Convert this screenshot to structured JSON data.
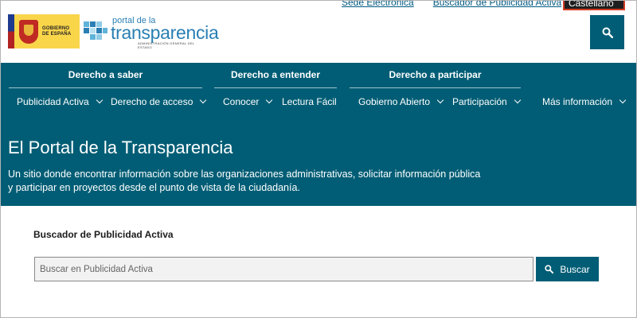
{
  "header": {
    "gobierno_logo_text": [
      "GOBIERNO",
      "DE ESPAÑA"
    ],
    "portal_logo": {
      "small": "portal de la",
      "big": "transparencia",
      "sub": "ADMINISTRACIÓN GENERAL DEL ESTADO"
    },
    "top_links": [
      "Sede Electrónica",
      "Buscador de Publicidad Activa"
    ],
    "language_label": "Castellano",
    "search_icon": "search-icon"
  },
  "nav": {
    "groups": [
      {
        "title": "Derecho a saber",
        "items": [
          "Publicidad Activa",
          "Derecho de acceso"
        ]
      },
      {
        "title": "Derecho a entender",
        "items": [
          "Conocer",
          "Lectura Fácil"
        ]
      },
      {
        "title": "Derecho a participar",
        "items": [
          "Gobierno Abierto",
          "Participación"
        ]
      }
    ],
    "more_label": "Más información"
  },
  "hero": {
    "title": "El Portal de la Transparencia",
    "description_line1": "Un sitio donde encontrar información sobre las organizaciones administrativas, solicitar información pública",
    "description_line2": "y participar en proyectos desde el punto de vista de la ciudadanía."
  },
  "search_panel": {
    "title": "Buscador de Publicidad Activa",
    "placeholder": "Buscar en Publicidad Activa",
    "button_label": "Buscar"
  },
  "colors": {
    "teal": "#015d75",
    "link": "#005a82",
    "logo_yellow": "#f9d54a",
    "lang_border": "#d33d24"
  }
}
